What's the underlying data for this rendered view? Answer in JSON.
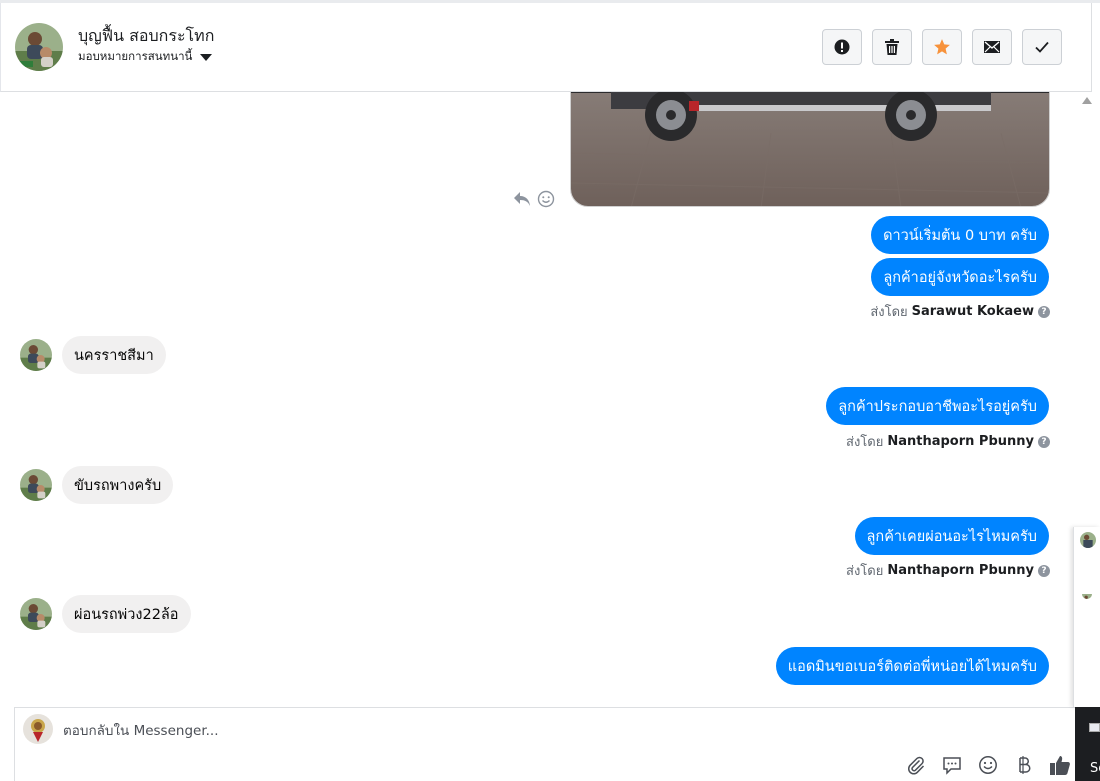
{
  "header": {
    "name": "บุญฟื้น สอบกระโทก",
    "assign_label": "มอบหมายการสนทนานี้",
    "toolbar": [
      {
        "name": "spam-button",
        "icon": "exclamation-icon"
      },
      {
        "name": "delete-button",
        "icon": "trash-icon"
      },
      {
        "name": "star-button",
        "icon": "star-icon",
        "color": "#f7923b"
      },
      {
        "name": "mark-unread-button",
        "icon": "envelope-icon"
      },
      {
        "name": "done-button",
        "icon": "checkmark-icon"
      }
    ]
  },
  "messages": {
    "out1": "ดาวน์เริ่มต้น 0 บาท ครับ",
    "out2": "ลูกค้าอยู่จังหวัดอะไรครับ",
    "sent_by_label": "ส่งโดย",
    "sender1": "Sarawut Kokaew",
    "in1": "นครราชสีมา",
    "out3": "ลูกค้าประกอบอาชีพอะไรอยู่ครับ",
    "sender2": "Nanthaporn Pbunny",
    "in2": "ขับรถพางครับ",
    "out4": "ลูกค้าเคยผ่อนอะไรไหมครับ",
    "sender3": "Nanthaporn Pbunny",
    "in3": "ผ่อนรถพ่วง22ล้อ",
    "out5": "แอดมินขอเบอร์ติดต่อพี่หน่อยได้ไหมครับ"
  },
  "composer": {
    "placeholder": "ตอบกลับใน Messenger..."
  },
  "side": {
    "partial_text": "Sc"
  },
  "colors": {
    "outgoing_bubble": "#0084ff",
    "incoming_bubble": "#f1f0f0",
    "star": "#f7923b"
  }
}
